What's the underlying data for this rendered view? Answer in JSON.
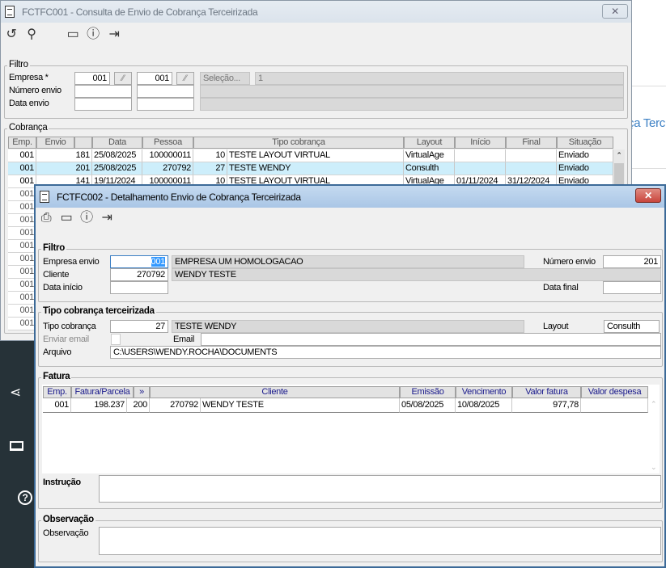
{
  "background": {
    "partial_text": "ça Terc"
  },
  "back_window": {
    "title": "FCTFC001 - Consulta de Envio de Cobrança Terceirizada",
    "toolbar": [
      "refresh-icon",
      "search-icon",
      "calendar-icon",
      "help-icon",
      "exit-icon"
    ],
    "filtro": {
      "legend": "Filtro",
      "empresa_label": "Empresa *",
      "empresa_from": "001",
      "empresa_to": "001",
      "selecao_button": "Seleção...",
      "selecao_value": "1",
      "numero_label": "Número envio",
      "data_label": "Data envio"
    },
    "cobranca": {
      "legend": "Cobrança",
      "columns": [
        "Emp.",
        "Envio",
        "",
        "Data",
        "Pessoa",
        "Tipo cobrança",
        "Layout",
        "Início",
        "Final",
        "Situação"
      ],
      "rows": [
        [
          "001",
          "181",
          "25/08/2025",
          "100000011",
          "10",
          "TESTE LAYOUT VIRTUAL",
          "VirtualAge",
          "",
          "",
          "Enviado"
        ],
        [
          "001",
          "201",
          "25/08/2025",
          "270792",
          "27",
          "TESTE WENDY",
          "Consulth",
          "",
          "",
          "Enviado"
        ],
        [
          "001",
          "141",
          "19/11/2024",
          "100000011",
          "10",
          "TESTE LAYOUT VIRTUAL",
          "VirtualAge",
          "01/11/2024",
          "31/12/2024",
          "Enviado"
        ]
      ],
      "hidden_rows_emp": [
        "001",
        "001",
        "001",
        "001",
        "001",
        "001",
        "001",
        "001",
        "001",
        "001",
        "001"
      ],
      "selected_row": 1
    }
  },
  "front_window": {
    "title": "FCTFC002 - Detalhamento Envio de Cobrança Terceirizada",
    "toolbar": [
      "print-icon",
      "calendar-icon",
      "help-icon",
      "exit-icon"
    ],
    "filtro": {
      "legend": "Filtro",
      "empresa_label": "Empresa envio",
      "empresa_value": "001",
      "empresa_desc": "EMPRESA UM HOMOLOGACAO",
      "numero_label": "Número envio",
      "numero_value": "201",
      "cliente_label": "Cliente",
      "cliente_value": "270792",
      "cliente_desc": "WENDY TESTE",
      "data_inicio_label": "Data início",
      "data_inicio_value": "",
      "data_final_label": "Data final",
      "data_final_value": ""
    },
    "tipo": {
      "legend": "Tipo cobrança terceirizada",
      "tipo_label": "Tipo cobrança",
      "tipo_value": "27",
      "tipo_desc": "TESTE WENDY",
      "layout_label": "Layout",
      "layout_value": "Consulth",
      "enviar_label": "Enviar email",
      "enviar_checked": false,
      "email_label": "Email",
      "email_value": "",
      "arquivo_label": "Arquivo",
      "arquivo_value": "C:\\USERS\\WENDY.ROCHA\\DOCUMENTS"
    },
    "fatura": {
      "legend": "Fatura",
      "columns": [
        "Emp.",
        "Fatura/Parcela",
        "»",
        "Cliente",
        "Emissão",
        "Vencimento",
        "Valor fatura",
        "Valor despesa"
      ],
      "rows": [
        {
          "emp": "001",
          "fatura": "198.237",
          "parcela": "200",
          "cliente_cod": "270792",
          "cliente_nome": "WENDY TESTE",
          "emissao": "05/08/2025",
          "vencimento": "10/08/2025",
          "valor_fatura": "977,78",
          "valor_despesa": ""
        }
      ],
      "instrucao_label": "Instrução",
      "instrucao_value": ""
    },
    "observacao": {
      "legend": "Observação",
      "label": "Observação",
      "value": ""
    }
  },
  "sidebar": {
    "icons": [
      "share-icon",
      "laptop-icon",
      "help-icon"
    ]
  },
  "colors": {
    "sidebar": "#263238",
    "selected_row": "#cdeefb",
    "header_text": "#1a1a8c",
    "close_button": "#c9463d"
  }
}
